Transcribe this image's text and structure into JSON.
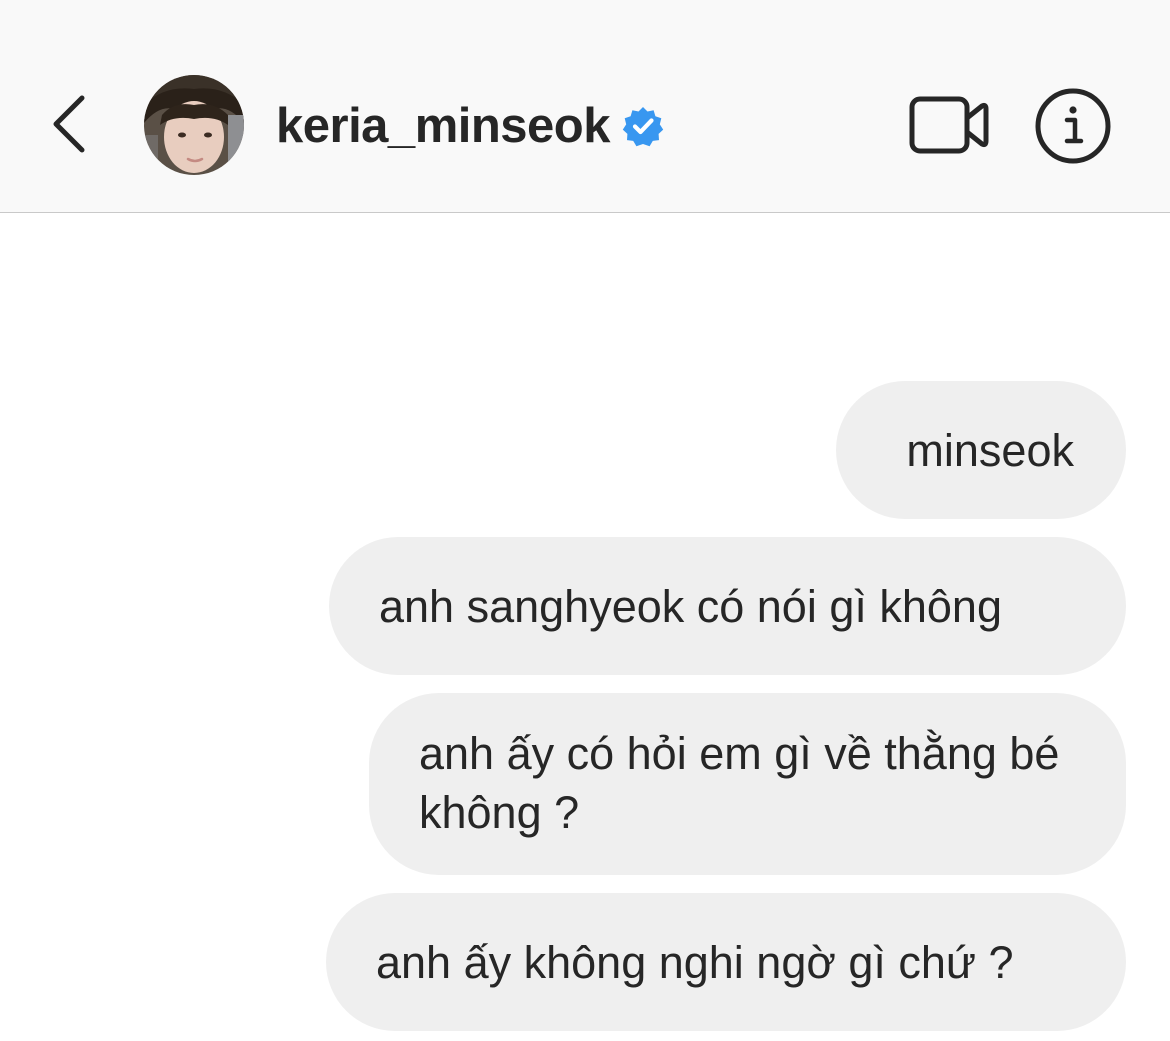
{
  "header": {
    "username": "keria_minseok",
    "verified": true,
    "back_icon": "chevron-left-icon",
    "video_icon": "video-camera-icon",
    "info_icon": "info-icon",
    "verified_color": "#3897f0"
  },
  "messages": [
    {
      "text": "minseok",
      "sender": "me"
    },
    {
      "text": "anh sanghyeok có nói gì không",
      "sender": "me"
    },
    {
      "text": "anh ấy có hỏi em gì về thằng bé không ?",
      "sender": "me"
    },
    {
      "text": "anh ấy không nghi ngờ gì chứ ?",
      "sender": "me"
    }
  ],
  "colors": {
    "header_bg": "#f9f9f9",
    "bubble_bg": "#efefef",
    "text": "#262626"
  }
}
